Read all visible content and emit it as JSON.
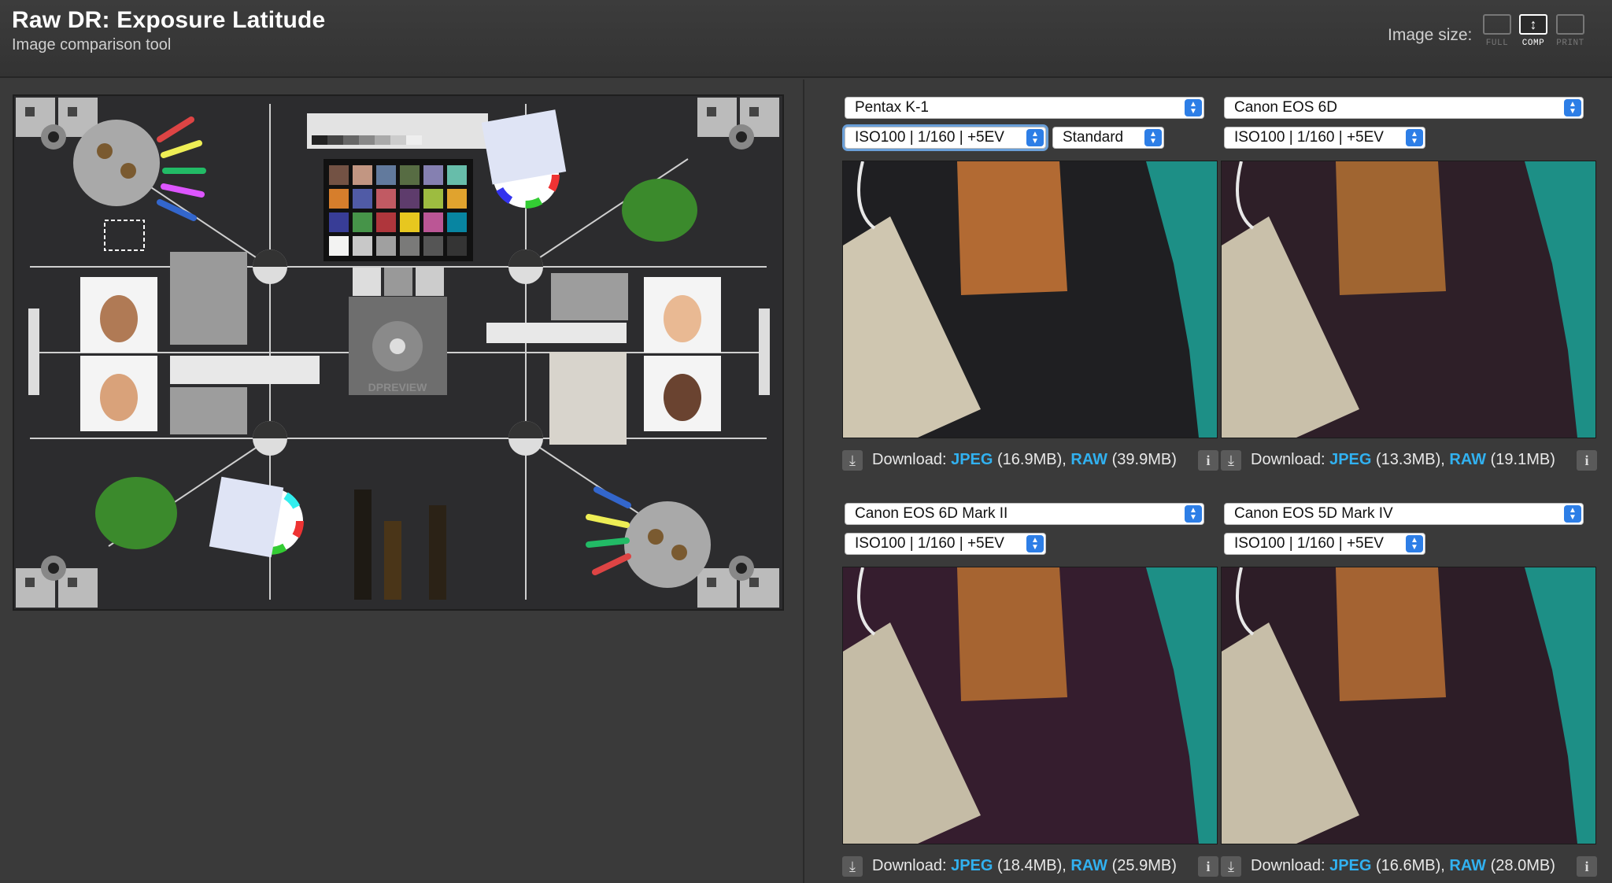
{
  "header": {
    "title": "Raw DR: Exposure Latitude",
    "subtitle": "Image comparison tool",
    "image_size_label": "Image size:",
    "size_options": [
      {
        "label": "FULL",
        "active": false
      },
      {
        "label": "COMP",
        "active": true
      },
      {
        "label": "PRINT",
        "active": false
      }
    ]
  },
  "overview": {
    "chart_text": "DPREVIEW"
  },
  "download_label": "Download:",
  "cells": [
    {
      "camera": "Pentax K-1",
      "setting": "ISO100 | 1/160 | +5EV",
      "profile": "Standard",
      "jpeg_link": "JPEG",
      "jpeg_size": "(16.9MB),",
      "raw_link": "RAW",
      "raw_size": "(39.9MB)"
    },
    {
      "camera": "Canon EOS 6D",
      "setting": "ISO100 | 1/160 | +5EV",
      "jpeg_link": "JPEG",
      "jpeg_size": "(13.3MB),",
      "raw_link": "RAW",
      "raw_size": "(19.1MB)"
    },
    {
      "camera": "Canon EOS 6D Mark II",
      "setting": "ISO100 | 1/160 | +5EV",
      "jpeg_link": "JPEG",
      "jpeg_size": "(18.4MB),",
      "raw_link": "RAW",
      "raw_size": "(25.9MB)"
    },
    {
      "camera": "Canon EOS 5D Mark IV",
      "setting": "ISO100 | 1/160 | +5EV",
      "jpeg_link": "JPEG",
      "jpeg_size": "(16.6MB),",
      "raw_link": "RAW",
      "raw_size": "(28.0MB)"
    }
  ],
  "colors": {
    "link": "#31b1f0",
    "select_spinner": "#2d7ee6",
    "background": "#3a3a3a"
  },
  "icons": {
    "download": "download-icon",
    "info": "info-icon",
    "select": "chevron-updown-icon"
  }
}
